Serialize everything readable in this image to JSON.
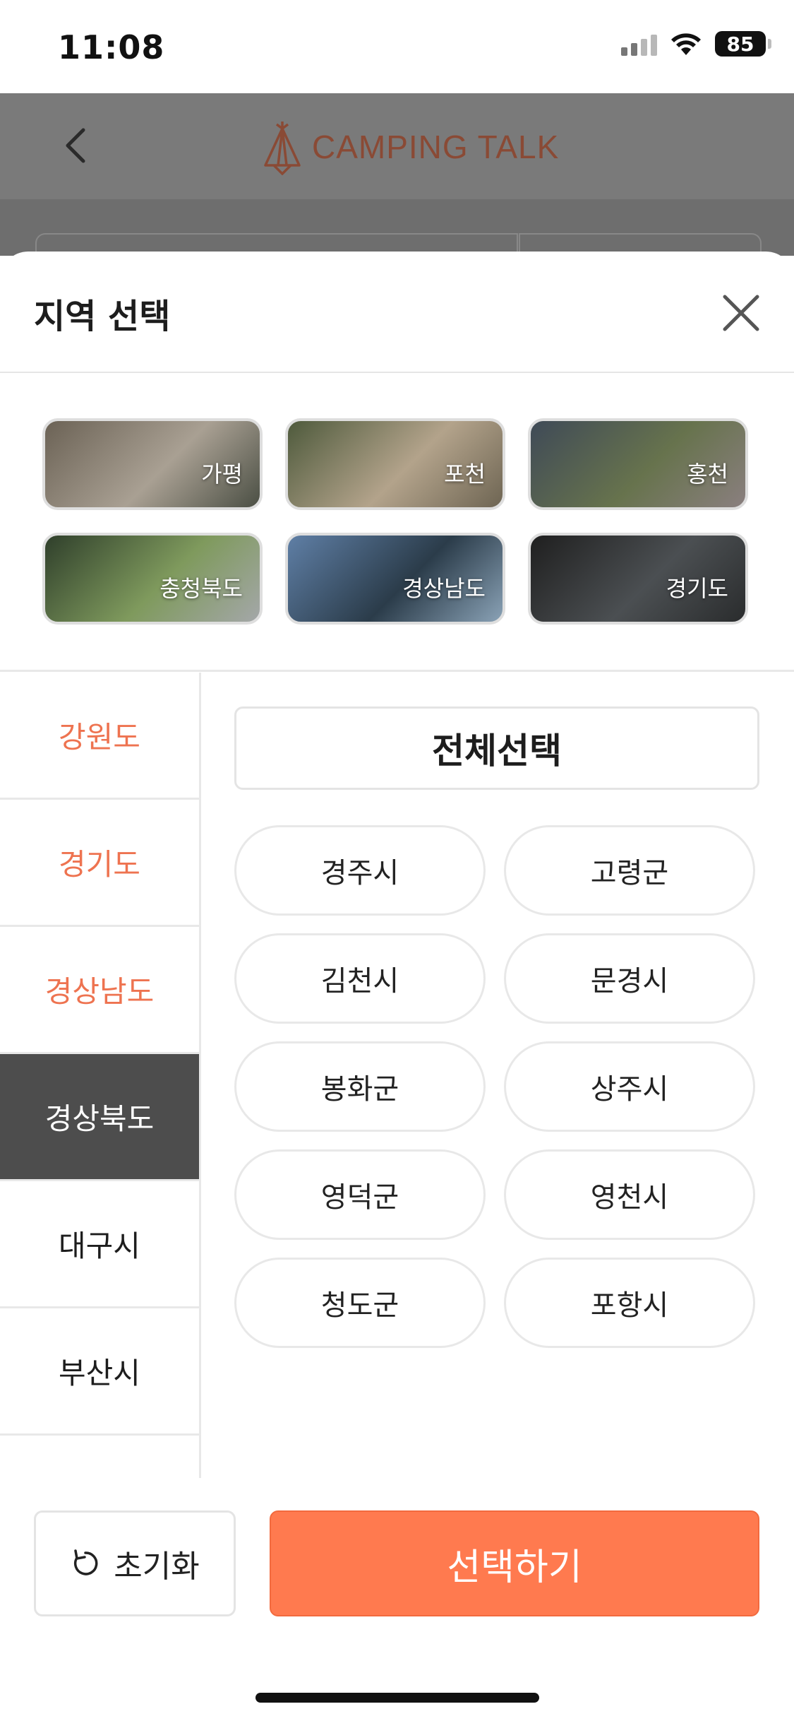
{
  "status_bar": {
    "time": "11:08",
    "battery": "85"
  },
  "app_header": {
    "logo_text": "CAMPING TALK"
  },
  "sheet": {
    "title": "지역 선택"
  },
  "popular_tiles": [
    {
      "label": "가평",
      "colors": [
        "#6b6255",
        "#a9a093",
        "#4b4f44"
      ]
    },
    {
      "label": "포천",
      "colors": [
        "#4e5a3c",
        "#b3a38b",
        "#6e6553"
      ]
    },
    {
      "label": "홍천",
      "colors": [
        "#3f4a57",
        "#67734d",
        "#8a7f7f"
      ]
    },
    {
      "label": "충청북도",
      "colors": [
        "#2f3f2b",
        "#7f9a5d",
        "#a4a7a9"
      ]
    },
    {
      "label": "경상남도",
      "colors": [
        "#5f7fa6",
        "#2b3c4a",
        "#8aa2b6"
      ]
    },
    {
      "label": "경기도",
      "colors": [
        "#1f1f1f",
        "#4b4f52",
        "#2a2c2d"
      ]
    }
  ],
  "provinces": [
    {
      "label": "강원도",
      "state": "orange"
    },
    {
      "label": "경기도",
      "state": "orange"
    },
    {
      "label": "경상남도",
      "state": "orange"
    },
    {
      "label": "경상북도",
      "state": "selected"
    },
    {
      "label": "대구시",
      "state": "dark"
    },
    {
      "label": "부산시",
      "state": "dark"
    }
  ],
  "select_all_label": "전체선택",
  "cities": [
    "경주시",
    "고령군",
    "김천시",
    "문경시",
    "봉화군",
    "상주시",
    "영덕군",
    "영천시",
    "청도군",
    "포항시"
  ],
  "footer": {
    "reset_label": "초기화",
    "submit_label": "선택하기"
  },
  "colors": {
    "accent": "#ff7a4f",
    "province_highlight": "#ee7350",
    "selected_bg": "#4d4d4d"
  }
}
